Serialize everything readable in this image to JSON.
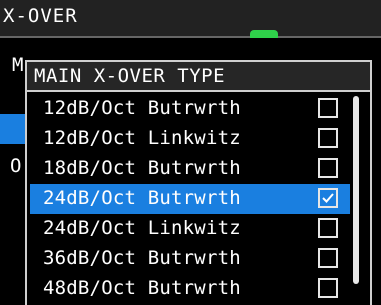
{
  "screen": {
    "title": "X-OVER"
  },
  "background": {
    "initial_1": "M",
    "initial_2": "O"
  },
  "popup": {
    "title": "MAIN X-OVER TYPE",
    "items": [
      {
        "label": "12dB/Oct Butrwrth",
        "checked": false
      },
      {
        "label": "12dB/Oct Linkwitz",
        "checked": false
      },
      {
        "label": "18dB/Oct Butrwrth",
        "checked": false
      },
      {
        "label": "24dB/Oct Butrwrth",
        "checked": true
      },
      {
        "label": "24dB/Oct Linkwitz",
        "checked": false
      },
      {
        "label": "36dB/Oct Butrwrth",
        "checked": false
      },
      {
        "label": "48dB/Oct Butrwrth",
        "checked": false
      }
    ]
  },
  "colors": {
    "selection": "#1a7fe0",
    "indicator": "#2fd14a"
  }
}
